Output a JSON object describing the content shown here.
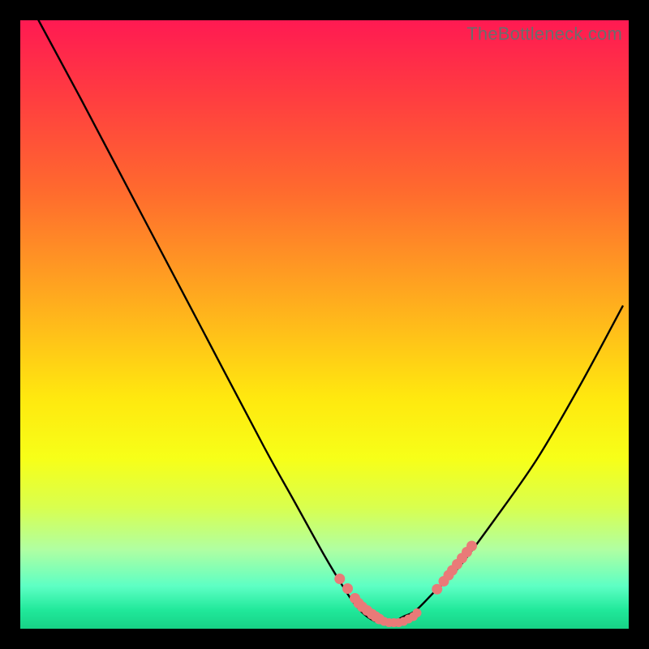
{
  "watermark": "TheBottleneck.com",
  "colors": {
    "frame_bg": "#000000",
    "curve_stroke": "#000000",
    "marker_fill": "#e97a78",
    "gradient_top": "#ff1a52",
    "gradient_bottom": "#17d286"
  },
  "chart_data": {
    "type": "line",
    "title": "",
    "xlabel": "",
    "ylabel": "",
    "xlim": [
      0,
      100
    ],
    "ylim": [
      0,
      100
    ],
    "grid": false,
    "legend": false,
    "series": [
      {
        "name": "bottleneck-curve",
        "x": [
          3,
          10,
          20,
          30,
          40,
          45,
          50,
          53,
          55,
          57,
          59,
          61,
          63,
          65,
          68,
          72,
          78,
          85,
          92,
          99
        ],
        "y": [
          100,
          87,
          68,
          49,
          30,
          21,
          12,
          7,
          4,
          2,
          1,
          1,
          2,
          3,
          6,
          10,
          18,
          28,
          40,
          53
        ]
      }
    ],
    "markers": {
      "left_cluster_x": [
        52.5,
        53.8,
        55.0,
        55.6,
        56.2,
        57.0,
        57.8,
        58.4,
        59.0
      ],
      "left_cluster_y": [
        8.2,
        6.6,
        5.0,
        4.2,
        3.6,
        3.0,
        2.4,
        2.0,
        1.6
      ],
      "bottom_cluster_x": [
        59.8,
        60.6,
        61.4,
        62.2,
        63.0,
        63.8,
        64.6,
        65.2
      ],
      "bottom_cluster_y": [
        1.2,
        1.0,
        1.0,
        1.0,
        1.2,
        1.6,
        2.0,
        2.6
      ],
      "right_cluster_x": [
        68.5,
        69.6,
        70.4,
        71.0,
        71.8,
        72.6,
        73.4,
        74.2
      ],
      "right_cluster_y": [
        6.5,
        7.8,
        8.8,
        9.6,
        10.6,
        11.6,
        12.6,
        13.6
      ]
    }
  }
}
